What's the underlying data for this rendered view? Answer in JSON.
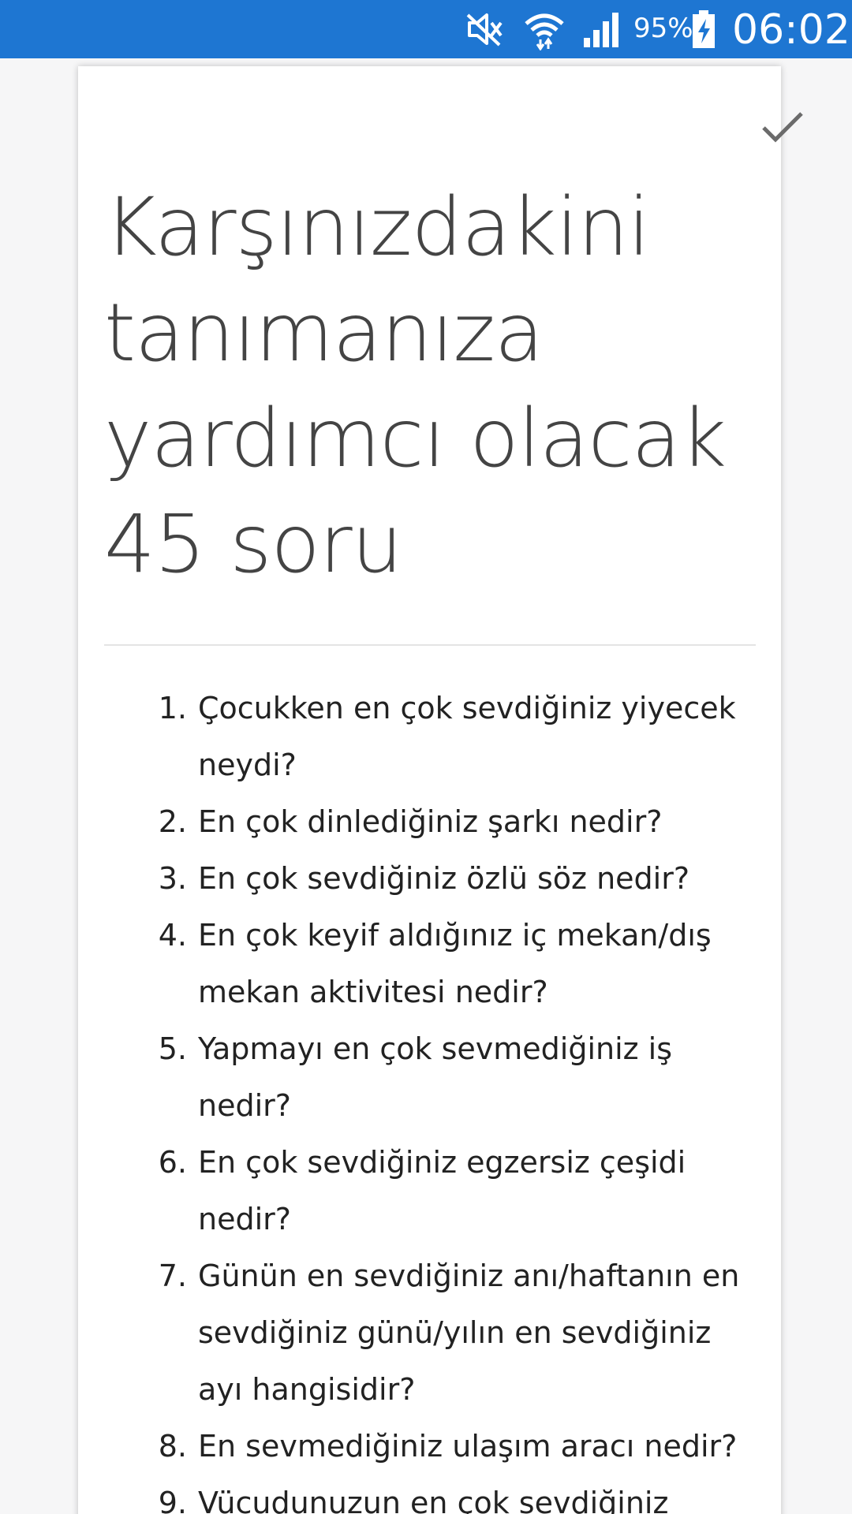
{
  "status_bar": {
    "battery_percent": "95%",
    "time": "06:02",
    "icons": [
      "mute-icon",
      "wifi-icon",
      "signal-icon",
      "battery-charging-icon"
    ],
    "background": "#1e76d2"
  },
  "article": {
    "done_icon": "check-icon",
    "title": "Karşınızdakini tanımanıza yardımcı olacak 45 soru",
    "questions": [
      {
        "num": "1.",
        "text": "Çocukken en çok sevdiğiniz yiyecek neydi?"
      },
      {
        "num": "2.",
        "text": "En çok dinlediğiniz şarkı nedir?"
      },
      {
        "num": "3.",
        "text": "En çok sevdiğiniz özlü söz nedir?"
      },
      {
        "num": "4.",
        "text": "En çok keyif aldığınız iç mekan/dış mekan aktivitesi nedir?"
      },
      {
        "num": "5.",
        "text": "Yapmayı en çok sevmediğiniz iş nedir?"
      },
      {
        "num": "6.",
        "text": "En çok sevdiğiniz egzersiz çeşidi nedir?"
      },
      {
        "num": "7.",
        "text": "Günün en sevdiğiniz anı/haftanın en sevdiğiniz günü/yılın en sevdiğiniz ayı hangisidir?"
      },
      {
        "num": "8.",
        "text": "En sevmediğiniz ulaşım aracı nedir?"
      },
      {
        "num": "9.",
        "text": "Vücudunuzun en çok sevdiğiniz"
      }
    ]
  }
}
